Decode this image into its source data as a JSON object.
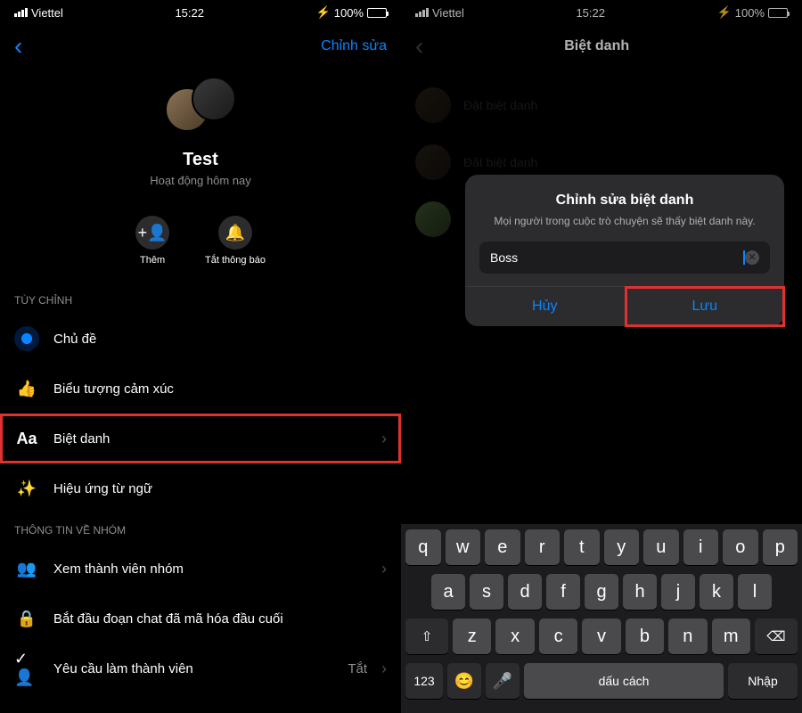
{
  "status": {
    "carrier": "Viettel",
    "time": "15:22",
    "battery": "100%",
    "charging_icon": "⚡"
  },
  "left": {
    "nav_edit": "Chỉnh sửa",
    "profile_name": "Test",
    "profile_status": "Hoạt động hôm nay",
    "action_add": "Thêm",
    "action_mute": "Tắt thông báo",
    "section_customize": "Tùy chỉnh",
    "item_theme": "Chủ đề",
    "item_emoji": "Biểu tượng cảm xúc",
    "item_nickname": "Biệt danh",
    "item_effects": "Hiệu ứng từ ngữ",
    "section_group_info": "Thông tin về nhóm",
    "item_members": "Xem thành viên nhóm",
    "item_encrypt": "Bắt đầu đoạn chat đã mã hóa đầu cuối",
    "item_approval": "Yêu cầu làm thành viên",
    "item_approval_value": "Tắt"
  },
  "right": {
    "nav_title": "Biệt danh",
    "nickname_placeholder": "Đặt biệt danh",
    "dialog_title": "Chỉnh sửa biệt danh",
    "dialog_subtitle": "Mọi người trong cuộc trò chuyện sẽ thấy biệt danh này.",
    "dialog_input_value": "Boss",
    "dialog_cancel": "Hủy",
    "dialog_save": "Lưu"
  },
  "keyboard": {
    "row1": [
      "q",
      "w",
      "e",
      "r",
      "t",
      "y",
      "u",
      "i",
      "o",
      "p"
    ],
    "row2": [
      "a",
      "s",
      "d",
      "f",
      "g",
      "h",
      "j",
      "k",
      "l"
    ],
    "row3": [
      "z",
      "x",
      "c",
      "v",
      "b",
      "n",
      "m"
    ],
    "num": "123",
    "space": "dấu cách",
    "enter": "Nhập"
  }
}
